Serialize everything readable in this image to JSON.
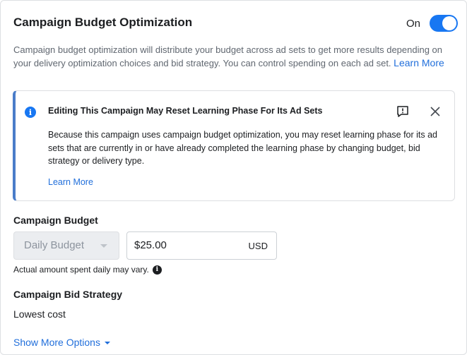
{
  "header": {
    "title": "Campaign Budget Optimization",
    "toggle_label": "On",
    "toggle_state": "on"
  },
  "description": {
    "text": "Campaign budget optimization will distribute your budget across ad sets to get more results depending on your delivery optimization choices and bid strategy. You can control spending on each ad set.",
    "link": "Learn More"
  },
  "alert": {
    "title": "Editing This Campaign May Reset Learning Phase For Its Ad Sets",
    "body": "Because this campaign uses campaign budget optimization, you may reset learning phase for its ad sets that are currently in or have already completed the learning phase by changing budget, bid strategy or delivery type.",
    "link": "Learn More",
    "icons": [
      "info-icon",
      "feedback-icon",
      "close-icon"
    ]
  },
  "budget": {
    "section_title": "Campaign Budget",
    "type_selected": "Daily Budget",
    "amount": "$25.00",
    "currency": "USD",
    "hint": "Actual amount spent daily may vary."
  },
  "bid_strategy": {
    "section_title": "Campaign Bid Strategy",
    "value": "Lowest cost"
  },
  "footer": {
    "more_options": "Show More Options"
  },
  "colors": {
    "accent": "#1877f2",
    "link": "#216fdb",
    "alert_border": "#4a7dc9",
    "muted_text": "#606770"
  }
}
